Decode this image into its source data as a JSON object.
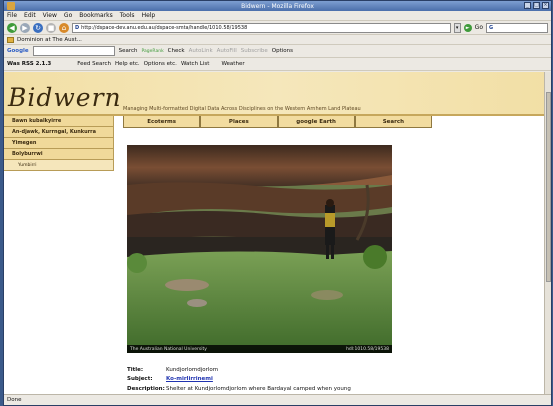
{
  "window": {
    "title": "Bidwern - Mozilla Firefox"
  },
  "menu": [
    "File",
    "Edit",
    "View",
    "Go",
    "Bookmarks",
    "Tools",
    "Help"
  ],
  "nav": {
    "url": "http://dspace-dev.anu.edu.au/dspace-smta/handle/1010.58/19538",
    "go_label": "Go",
    "search_placeholder": "G"
  },
  "bookmarks": {
    "item": "Dominion at The Aust..."
  },
  "googlebar": {
    "label": "Google",
    "search": "Search",
    "pagerank": "PageRank",
    "check": "Check",
    "autolink": "AutoLink",
    "autofill": "AutoFill",
    "subscribe": "Subscribe",
    "options": "Options"
  },
  "webbar": {
    "rss": "Was RSS 2.1.3",
    "feed_search": "Feed Search",
    "help": "Help etc.",
    "options": "Options etc.",
    "watch": "Watch List",
    "weather": "Weather"
  },
  "site": {
    "logo": "Bidwern",
    "tagline": "Managing Multi-formatted Digital Data Across Disciplines on the Western Arnhem Land Plateau",
    "tabs": [
      "Ecoterms",
      "Places",
      "google Earth",
      "Search"
    ],
    "sidebar": [
      {
        "label": "Bawn kubalkyirre"
      },
      {
        "label": "An-djawk, Kurrngal, Kunkurra"
      },
      {
        "label": "Yimegen"
      },
      {
        "label": "Bolyburrwi"
      },
      {
        "label": "Yumbirri",
        "sub": true
      }
    ]
  },
  "photo": {
    "caption_left": "The Australian National University",
    "caption_right": "hdl:1010.58/19538"
  },
  "record": {
    "title_key": "Title:",
    "title_val": "Kundjorlomdjorlom",
    "subject_key": "Subject:",
    "subject_val": "Ko-mirlirrinemi",
    "desc_key": "Description:",
    "desc_val": "Shelter at Kundjorlomdjorlom where Bardayal camped when young"
  },
  "status": {
    "text": "Done"
  }
}
